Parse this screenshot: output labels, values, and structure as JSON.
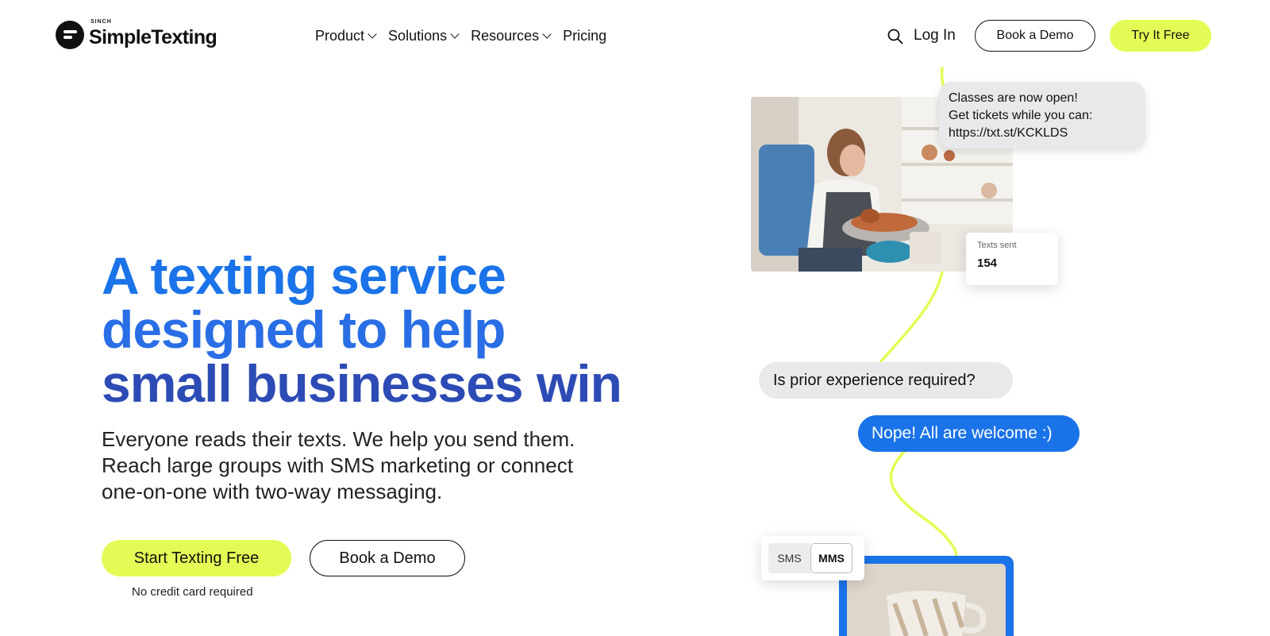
{
  "header": {
    "logo_sinch": "SINCH",
    "logo_name": "SimpleTexting",
    "nav": [
      {
        "label": "Product"
      },
      {
        "label": "Solutions"
      },
      {
        "label": "Resources"
      },
      {
        "label": "Pricing"
      }
    ],
    "login_label": "Log In",
    "book_demo_label": "Book a Demo",
    "try_free_label": "Try It Free"
  },
  "hero": {
    "title_line1": "A texting service",
    "title_line2": "designed to help",
    "title_line3": "small businesses win",
    "subtitle": "Everyone reads their texts. We help you send them. Reach large groups with SMS marketing or connect one-on-one with two-way messaging.",
    "cta_primary": "Start Texting Free",
    "cta_secondary": "Book a Demo",
    "note": "No credit card required"
  },
  "illustration": {
    "message1_line1": "Classes are now open!",
    "message1_line2": "Get tickets while you can:",
    "message1_line3": "https://txt.st/KCKLDS",
    "stats_label": "Texts sent",
    "stats_value": "154",
    "question": "Is prior experience required?",
    "answer": "Nope! All are welcome :)",
    "toggle_sms": "SMS",
    "toggle_mms": "MMS"
  },
  "colors": {
    "accent_lime": "#e5fb55",
    "brand_blue": "#1a73e8",
    "title_dark_blue": "#2d4bb5",
    "bubble_gray": "#e9e9eb"
  }
}
